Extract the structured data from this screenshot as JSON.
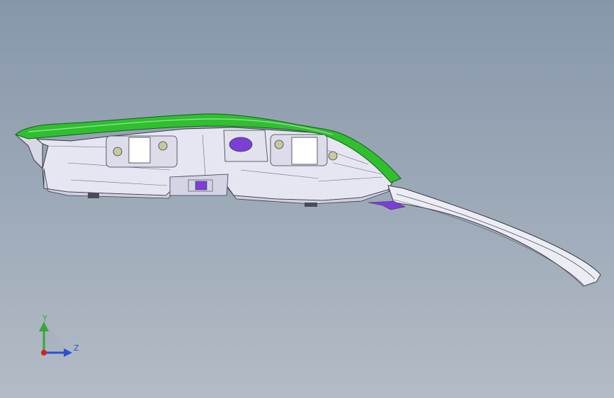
{
  "viewport": {
    "background_top": "#8797ab",
    "background_bottom": "#b3bcc6"
  },
  "model": {
    "body_color": "#e6e6f2",
    "edge_color": "#3a3a48",
    "top_surface_color": "#2fbf2f",
    "feature_color": "#7b3fd6"
  },
  "triad": {
    "y_label": "Y",
    "z_label": "Z",
    "y_color": "#3aa63a",
    "z_color": "#2e4fd6",
    "x_color": "#d42020"
  }
}
